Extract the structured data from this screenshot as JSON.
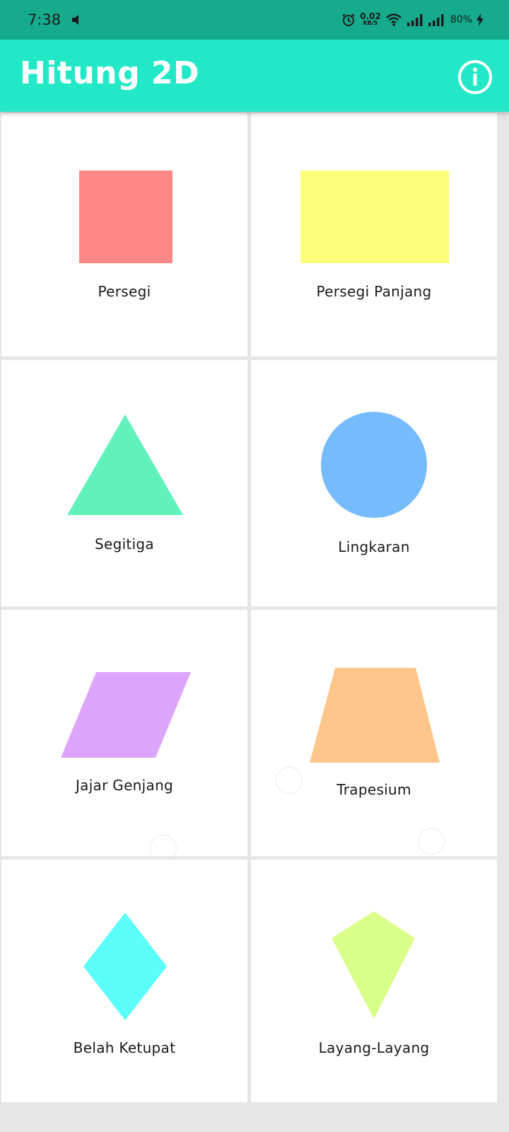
{
  "status_bar": {
    "time": "7:38",
    "network_speed_value": "0.02",
    "network_speed_unit": "KB/S",
    "battery": "80%"
  },
  "app_bar": {
    "title": "Hitung 2D",
    "info_icon": "info-icon"
  },
  "shapes": [
    {
      "label": "Persegi",
      "color": "#ff8785"
    },
    {
      "label": "Persegi Panjang",
      "color": "#fbfe7a"
    },
    {
      "label": "Segitiga",
      "color": "#61f1bb"
    },
    {
      "label": "Lingkaran",
      "color": "#75bbfd"
    },
    {
      "label": "Jajar Genjang",
      "color": "#dda5fd"
    },
    {
      "label": "Trapesium",
      "color": "#ffc68b"
    },
    {
      "label": "Belah Ketupat",
      "color": "#5cfef9"
    },
    {
      "label": "Layang-Layang",
      "color": "#dafe8a"
    }
  ]
}
